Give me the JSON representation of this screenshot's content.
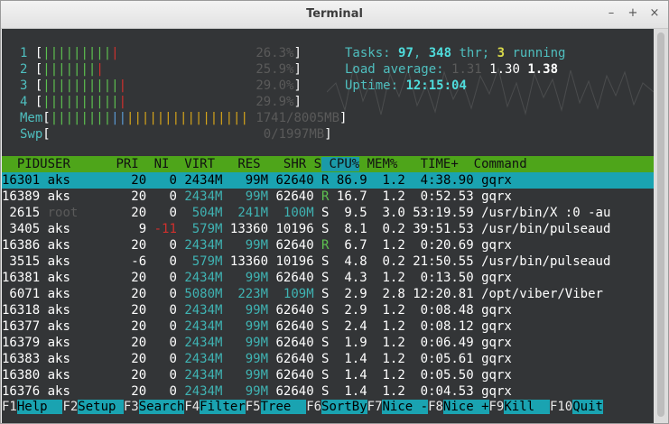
{
  "window": {
    "title": "Terminal"
  },
  "meters": {
    "cpus": [
      {
        "n": "1",
        "bar": "||||||||||",
        "pct": "26.3%"
      },
      {
        "n": "2",
        "bar": "||||||||",
        "pct": "25.9%"
      },
      {
        "n": "3",
        "bar": "|||||||||||",
        "pct": "29.0%"
      },
      {
        "n": "4",
        "bar": "|||||||||||",
        "pct": "29.9%"
      }
    ],
    "mem": {
      "label": "Mem",
      "bar": "||||||||||||||||||||||||||",
      "value": "1741/8005MB"
    },
    "swp": {
      "label": "Swp",
      "value": "0/1997MB"
    }
  },
  "summary": {
    "tasks_label": "Tasks: ",
    "tasks": "97",
    "threads": "348",
    "thr_label": " thr; ",
    "running": "3",
    "running_label": " running",
    "load_label": "Load average: ",
    "load1": "1.31",
    "load5": "1.30",
    "load15": "1.38",
    "uptime_label": "Uptime: ",
    "uptime": "12:15:04"
  },
  "table": {
    "headers": [
      "  PID",
      "USER     ",
      " PRI",
      "  NI",
      "  VIRT",
      "   RES",
      "   SHR",
      " S",
      " CPU%",
      " MEM%",
      "   TIME+ ",
      " Command"
    ],
    "rows": [
      {
        "pid": "16301",
        "user": "aks  ",
        "pri": "20",
        "ni": "0",
        "virt": "2434M",
        "res": "99M",
        "shr": "62640",
        "s": "R",
        "cpu": "86.9",
        "mem": "1.2",
        "time": "4:38.90",
        "cmd": "gqrx"
      },
      {
        "pid": "16389",
        "user": "aks  ",
        "pri": "20",
        "ni": "0",
        "virt": "2434M",
        "res": "99M",
        "shr": "62640",
        "s": "R",
        "cpu": "16.7",
        "mem": "1.2",
        "time": "0:52.53",
        "cmd": "gqrx"
      },
      {
        "pid": "2615",
        "user": "root ",
        "pri": "20",
        "ni": "0",
        "virt": "504M",
        "res": "241M",
        "shr": "100M",
        "s": "S",
        "cpu": "9.5",
        "mem": "3.0",
        "time": "53:19.59",
        "cmd": "/usr/bin/X :0 -au"
      },
      {
        "pid": "3405",
        "user": "aks  ",
        "pri": "9",
        "ni": "-11",
        "virt": "579M",
        "res": "13360",
        "shr": "10196",
        "s": "S",
        "cpu": "8.1",
        "mem": "0.2",
        "time": "39:51.53",
        "cmd": "/usr/bin/pulseaud"
      },
      {
        "pid": "16386",
        "user": "aks  ",
        "pri": "20",
        "ni": "0",
        "virt": "2434M",
        "res": "99M",
        "shr": "62640",
        "s": "R",
        "cpu": "6.7",
        "mem": "1.2",
        "time": "0:20.69",
        "cmd": "gqrx"
      },
      {
        "pid": "3515",
        "user": "aks  ",
        "pri": "-6",
        "ni": "0",
        "virt": "579M",
        "res": "13360",
        "shr": "10196",
        "s": "S",
        "cpu": "4.8",
        "mem": "0.2",
        "time": "21:50.55",
        "cmd": "/usr/bin/pulseaud"
      },
      {
        "pid": "16381",
        "user": "aks  ",
        "pri": "20",
        "ni": "0",
        "virt": "2434M",
        "res": "99M",
        "shr": "62640",
        "s": "S",
        "cpu": "4.3",
        "mem": "1.2",
        "time": "0:13.50",
        "cmd": "gqrx"
      },
      {
        "pid": "6071",
        "user": "aks  ",
        "pri": "20",
        "ni": "0",
        "virt": "5080M",
        "res": "223M",
        "shr": "109M",
        "s": "S",
        "cpu": "2.9",
        "mem": "2.8",
        "time": "12:20.81",
        "cmd": "/opt/viber/Viber"
      },
      {
        "pid": "16318",
        "user": "aks  ",
        "pri": "20",
        "ni": "0",
        "virt": "2434M",
        "res": "99M",
        "shr": "62640",
        "s": "S",
        "cpu": "2.9",
        "mem": "1.2",
        "time": "0:08.48",
        "cmd": "gqrx"
      },
      {
        "pid": "16377",
        "user": "aks  ",
        "pri": "20",
        "ni": "0",
        "virt": "2434M",
        "res": "99M",
        "shr": "62640",
        "s": "S",
        "cpu": "2.4",
        "mem": "1.2",
        "time": "0:08.12",
        "cmd": "gqrx"
      },
      {
        "pid": "16379",
        "user": "aks  ",
        "pri": "20",
        "ni": "0",
        "virt": "2434M",
        "res": "99M",
        "shr": "62640",
        "s": "S",
        "cpu": "1.9",
        "mem": "1.2",
        "time": "0:06.49",
        "cmd": "gqrx"
      },
      {
        "pid": "16383",
        "user": "aks  ",
        "pri": "20",
        "ni": "0",
        "virt": "2434M",
        "res": "99M",
        "shr": "62640",
        "s": "S",
        "cpu": "1.4",
        "mem": "1.2",
        "time": "0:05.61",
        "cmd": "gqrx"
      },
      {
        "pid": "16380",
        "user": "aks  ",
        "pri": "20",
        "ni": "0",
        "virt": "2434M",
        "res": "99M",
        "shr": "62640",
        "s": "S",
        "cpu": "1.4",
        "mem": "1.2",
        "time": "0:05.50",
        "cmd": "gqrx"
      },
      {
        "pid": "16376",
        "user": "aks  ",
        "pri": "20",
        "ni": "0",
        "virt": "2434M",
        "res": "99M",
        "shr": "62640",
        "s": "S",
        "cpu": "1.4",
        "mem": "1.2",
        "time": "0:04.53",
        "cmd": "gqrx"
      }
    ]
  },
  "footer": [
    {
      "key": "F1",
      "label": "Help  "
    },
    {
      "key": "F2",
      "label": "Setup "
    },
    {
      "key": "F3",
      "label": "Search"
    },
    {
      "key": "F4",
      "label": "Filter"
    },
    {
      "key": "F5",
      "label": "Tree  "
    },
    {
      "key": "F6",
      "label": "SortBy"
    },
    {
      "key": "F7",
      "label": "Nice -"
    },
    {
      "key": "F8",
      "label": "Nice +"
    },
    {
      "key": "F9",
      "label": "Kill  "
    },
    {
      "key": "F10",
      "label": "Quit"
    }
  ],
  "colors": {
    "terminal_bg": "#333537",
    "header_bg": "#4ea51a",
    "selection_bg": "#1aa3b1",
    "label_cyan": "#4fbfbf"
  }
}
